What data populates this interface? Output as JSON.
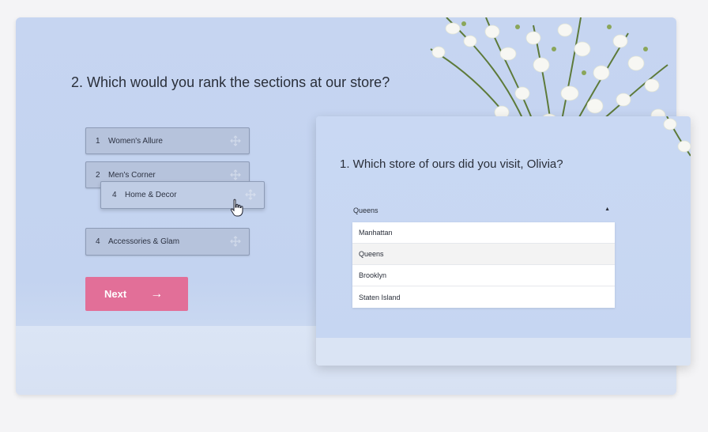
{
  "survey_back": {
    "question_title": "2. Which would you rank the sections at our store?",
    "rank_items": [
      {
        "num": "1",
        "label": "Women's Allure"
      },
      {
        "num": "2",
        "label": "Men's Corner"
      },
      {
        "num": "4",
        "label": "Home & Decor"
      },
      {
        "num": "4",
        "label": "Accessories & Glam"
      }
    ],
    "next_label": "Next",
    "next_arrow": "→",
    "drag_icon": "move-icon",
    "cursor_icon": "hand-pointer-icon"
  },
  "survey_front": {
    "question_title": "1. Which store of ours did you visit, Olivia?",
    "dropdown": {
      "selected": "Queens",
      "caret": "▲",
      "options": [
        "Manhattan",
        "Queens",
        "Brooklyn",
        "Staten Island"
      ]
    }
  },
  "colors": {
    "accent_button": "#e26f98",
    "card_background": "#c6d5f1",
    "rank_item": "#b6c3dc"
  }
}
